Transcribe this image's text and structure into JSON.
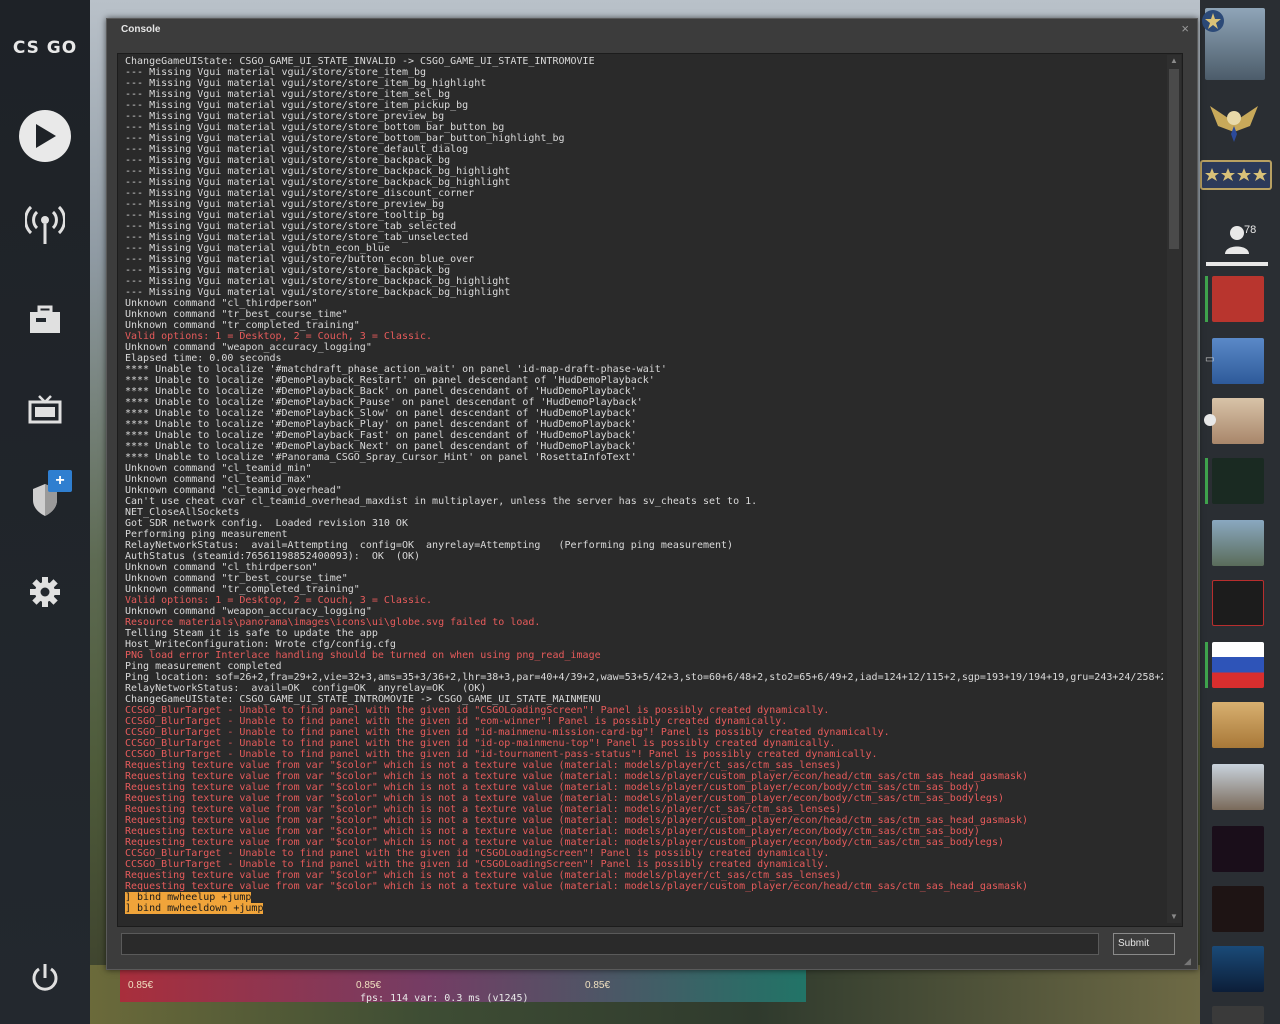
{
  "app": {
    "logo": "CS GO"
  },
  "console": {
    "title": "Console",
    "close": "×",
    "submit_label": "Submit",
    "input_value": "",
    "lines": [
      {
        "t": "ChangeGameUIState: CSGO_GAME_UI_STATE_INVALID -> CSGO_GAME_UI_STATE_INTROMOVIE",
        "c": "n"
      },
      {
        "t": "--- Missing Vgui material vgui/store/store_item_bg",
        "c": "n"
      },
      {
        "t": "--- Missing Vgui material vgui/store/store_item_bg_highlight",
        "c": "n"
      },
      {
        "t": "--- Missing Vgui material vgui/store/store_item_sel_bg",
        "c": "n"
      },
      {
        "t": "--- Missing Vgui material vgui/store/store_item_pickup_bg",
        "c": "n"
      },
      {
        "t": "--- Missing Vgui material vgui/store/store_preview_bg",
        "c": "n"
      },
      {
        "t": "--- Missing Vgui material vgui/store/store_bottom_bar_button_bg",
        "c": "n"
      },
      {
        "t": "--- Missing Vgui material vgui/store/store_bottom_bar_button_highlight_bg",
        "c": "n"
      },
      {
        "t": "--- Missing Vgui material vgui/store/store_default_dialog",
        "c": "n"
      },
      {
        "t": "--- Missing Vgui material vgui/store/store_backpack_bg",
        "c": "n"
      },
      {
        "t": "--- Missing Vgui material vgui/store/store_backpack_bg_highlight",
        "c": "n"
      },
      {
        "t": "--- Missing Vgui material vgui/store/store_backpack_bg_highlight",
        "c": "n"
      },
      {
        "t": "--- Missing Vgui material vgui/store/store_discount_corner",
        "c": "n"
      },
      {
        "t": "--- Missing Vgui material vgui/store/store_preview_bg",
        "c": "n"
      },
      {
        "t": "--- Missing Vgui material vgui/store/store_tooltip_bg",
        "c": "n"
      },
      {
        "t": "--- Missing Vgui material vgui/store/store_tab_selected",
        "c": "n"
      },
      {
        "t": "--- Missing Vgui material vgui/store/store_tab_unselected",
        "c": "n"
      },
      {
        "t": "--- Missing Vgui material vgui/btn_econ_blue",
        "c": "n"
      },
      {
        "t": "--- Missing Vgui material vgui/store/button_econ_blue_over",
        "c": "n"
      },
      {
        "t": "--- Missing Vgui material vgui/store/store_backpack_bg",
        "c": "n"
      },
      {
        "t": "--- Missing Vgui material vgui/store/store_backpack_bg_highlight",
        "c": "n"
      },
      {
        "t": "--- Missing Vgui material vgui/store/store_backpack_bg_highlight",
        "c": "n"
      },
      {
        "t": "Unknown command \"cl_thirdperson\"",
        "c": "n"
      },
      {
        "t": "Unknown command \"tr_best_course_time\"",
        "c": "n"
      },
      {
        "t": "Unknown command \"tr_completed_training\"",
        "c": "n"
      },
      {
        "t": "Valid options: 1 = Desktop, 2 = Couch, 3 = Classic.",
        "c": "r"
      },
      {
        "t": "Unknown command \"weapon_accuracy_logging\"",
        "c": "n"
      },
      {
        "t": "Elapsed time: 0.00 seconds",
        "c": "n"
      },
      {
        "t": "**** Unable to localize '#matchdraft_phase_action_wait' on panel 'id-map-draft-phase-wait'",
        "c": "n"
      },
      {
        "t": "**** Unable to localize '#DemoPlayback_Restart' on panel descendant of 'HudDemoPlayback'",
        "c": "n"
      },
      {
        "t": "**** Unable to localize '#DemoPlayback_Back' on panel descendant of 'HudDemoPlayback'",
        "c": "n"
      },
      {
        "t": "**** Unable to localize '#DemoPlayback_Pause' on panel descendant of 'HudDemoPlayback'",
        "c": "n"
      },
      {
        "t": "**** Unable to localize '#DemoPlayback_Slow' on panel descendant of 'HudDemoPlayback'",
        "c": "n"
      },
      {
        "t": "**** Unable to localize '#DemoPlayback_Play' on panel descendant of 'HudDemoPlayback'",
        "c": "n"
      },
      {
        "t": "**** Unable to localize '#DemoPlayback_Fast' on panel descendant of 'HudDemoPlayback'",
        "c": "n"
      },
      {
        "t": "**** Unable to localize '#DemoPlayback_Next' on panel descendant of 'HudDemoPlayback'",
        "c": "n"
      },
      {
        "t": "**** Unable to localize '#Panorama_CSGO_Spray_Cursor_Hint' on panel 'RosettaInfoText'",
        "c": "n"
      },
      {
        "t": "Unknown command \"cl_teamid_min\"",
        "c": "n"
      },
      {
        "t": "Unknown command \"cl_teamid_max\"",
        "c": "n"
      },
      {
        "t": "Unknown command \"cl_teamid_overhead\"",
        "c": "n"
      },
      {
        "t": "Can't use cheat cvar cl_teamid_overhead_maxdist in multiplayer, unless the server has sv_cheats set to 1.",
        "c": "n"
      },
      {
        "t": "NET_CloseAllSockets",
        "c": "n"
      },
      {
        "t": "Got SDR network config.  Loaded revision 310 OK",
        "c": "n"
      },
      {
        "t": "Performing ping measurement",
        "c": "n"
      },
      {
        "t": "RelayNetworkStatus:  avail=Attempting  config=OK  anyrelay=Attempting   (Performing ping measurement)",
        "c": "n"
      },
      {
        "t": "AuthStatus (steamid:76561198852400093):  OK  (OK)",
        "c": "n"
      },
      {
        "t": "Unknown command \"cl_thirdperson\"",
        "c": "n"
      },
      {
        "t": "Unknown command \"tr_best_course_time\"",
        "c": "n"
      },
      {
        "t": "Unknown command \"tr_completed_training\"",
        "c": "n"
      },
      {
        "t": "Valid options: 1 = Desktop, 2 = Couch, 3 = Classic.",
        "c": "r"
      },
      {
        "t": "Unknown command \"weapon_accuracy_logging\"",
        "c": "n"
      },
      {
        "t": "Resource materials\\panorama\\images\\icons\\ui\\globe.svg failed to load.",
        "c": "r"
      },
      {
        "t": "Telling Steam it is safe to update the app",
        "c": "n"
      },
      {
        "t": "Host_WriteConfiguration: Wrote cfg/config.cfg",
        "c": "n"
      },
      {
        "t": "PNG load error Interlace handling should be turned on when using png_read_image",
        "c": "r"
      },
      {
        "t": "Ping measurement completed",
        "c": "n"
      },
      {
        "t": "Ping location: sof=26+2,fra=29+2,vie=32+3,ams=35+3/36+2,lhr=38+3,par=40+4/39+2,waw=53+5/42+3,sto=60+6/48+2,sto2=65+6/49+2,iad=124+12/115+2,sgp=193+19/194+19,gru=243+24/258+2",
        "c": "n"
      },
      {
        "t": "RelayNetworkStatus:  avail=OK  config=OK  anyrelay=OK   (OK)",
        "c": "n"
      },
      {
        "t": "ChangeGameUIState: CSGO_GAME_UI_STATE_INTROMOVIE -> CSGO_GAME_UI_STATE_MAINMENU",
        "c": "n"
      },
      {
        "t": "CCSGO_BlurTarget - Unable to find panel with the given id \"CSGOLoadingScreen\"! Panel is possibly created dynamically.",
        "c": "r"
      },
      {
        "t": "CCSGO_BlurTarget - Unable to find panel with the given id \"eom-winner\"! Panel is possibly created dynamically.",
        "c": "r"
      },
      {
        "t": "CCSGO_BlurTarget - Unable to find panel with the given id \"id-mainmenu-mission-card-bg\"! Panel is possibly created dynamically.",
        "c": "r"
      },
      {
        "t": "CCSGO_BlurTarget - Unable to find panel with the given id \"id-op-mainmenu-top\"! Panel is possibly created dynamically.",
        "c": "r"
      },
      {
        "t": "CCSGO_BlurTarget - Unable to find panel with the given id \"id-tournament-pass-status\"! Panel is possibly created dynamically.",
        "c": "r"
      },
      {
        "t": "Requesting texture value from var \"$color\" which is not a texture value (material: models/player/ct_sas/ctm_sas_lenses)",
        "c": "r"
      },
      {
        "t": "Requesting texture value from var \"$color\" which is not a texture value (material: models/player/custom_player/econ/head/ctm_sas/ctm_sas_head_gasmask)",
        "c": "r"
      },
      {
        "t": "Requesting texture value from var \"$color\" which is not a texture value (material: models/player/custom_player/econ/body/ctm_sas/ctm_sas_body)",
        "c": "r"
      },
      {
        "t": "Requesting texture value from var \"$color\" which is not a texture value (material: models/player/custom_player/econ/body/ctm_sas/ctm_sas_bodylegs)",
        "c": "r"
      },
      {
        "t": "Requesting texture value from var \"$color\" which is not a texture value (material: models/player/ct_sas/ctm_sas_lenses)",
        "c": "r"
      },
      {
        "t": "Requesting texture value from var \"$color\" which is not a texture value (material: models/player/custom_player/econ/head/ctm_sas/ctm_sas_head_gasmask)",
        "c": "r"
      },
      {
        "t": "Requesting texture value from var \"$color\" which is not a texture value (material: models/player/custom_player/econ/body/ctm_sas/ctm_sas_body)",
        "c": "r"
      },
      {
        "t": "Requesting texture value from var \"$color\" which is not a texture value (material: models/player/custom_player/econ/body/ctm_sas/ctm_sas_bodylegs)",
        "c": "r"
      },
      {
        "t": "CCSGO_BlurTarget - Unable to find panel with the given id \"CSGOLoadingScreen\"! Panel is possibly created dynamically.",
        "c": "r"
      },
      {
        "t": "CCSGO_BlurTarget - Unable to find panel with the given id \"CSGOLoadingScreen\"! Panel is possibly created dynamically.",
        "c": "r"
      },
      {
        "t": "Requesting texture value from var \"$color\" which is not a texture value (material: models/player/ct_sas/ctm_sas_lenses)",
        "c": "r"
      },
      {
        "t": "Requesting texture value from var \"$color\" which is not a texture value (material: models/player/custom_player/econ/head/ctm_sas/ctm_sas_head_gasmask)",
        "c": "r"
      },
      {
        "t": "] bind mwheelup +jump",
        "c": "h"
      },
      {
        "t": "] bind mwheeldown +jump",
        "c": "h"
      }
    ]
  },
  "friends": {
    "count": "78"
  },
  "bottom": {
    "prices": [
      "0.85€",
      "0.85€",
      "0.85€"
    ],
    "fps_text": "fps:   114  var:  0.3 ms (v1245)"
  },
  "colors": {
    "log_normal": "#d9d9d9",
    "log_red": "#e65b5b",
    "highlight": "#f0a43a",
    "status_green": "#3fa34d"
  }
}
